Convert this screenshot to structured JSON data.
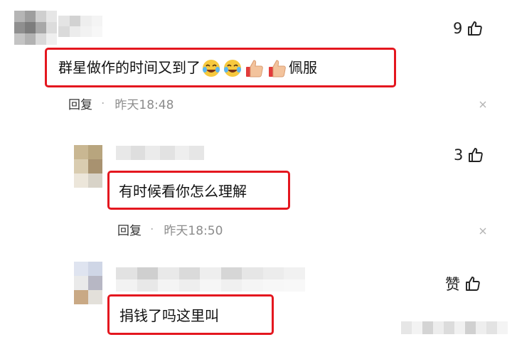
{
  "comments": [
    {
      "text_before_emoji": "群星做作的时间又到了",
      "emojis": [
        "crying-laugh-emoji",
        "crying-laugh-emoji",
        "thumbs-up-emoji",
        "thumbs-up-emoji"
      ],
      "text_after_emoji": "佩服",
      "reply_label": "回复",
      "separator": "·",
      "time": "昨天18:48",
      "like_count": "9"
    },
    {
      "text": "有时候看你怎么理解",
      "reply_label": "回复",
      "separator": "·",
      "time": "昨天18:50",
      "like_count": "3"
    },
    {
      "text": "捐钱了吗这里叫",
      "like_label": "赞"
    }
  ],
  "colors": {
    "highlight_border": "#e4171f",
    "meta_time": "#8c8c8c",
    "separator": "#b0b0b0"
  },
  "icons": [
    "thumbs-up-icon",
    "close-icon"
  ]
}
